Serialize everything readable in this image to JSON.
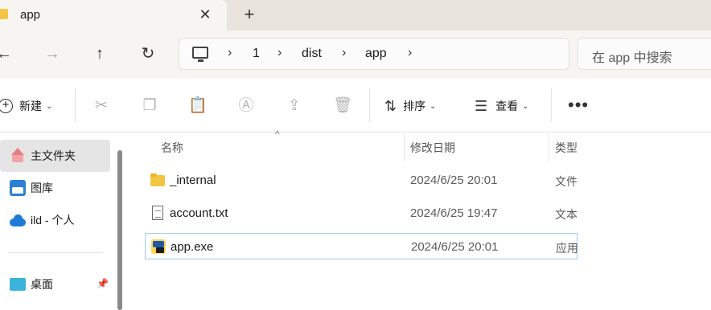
{
  "tab": {
    "title": "app",
    "close": "✕",
    "new_tab": "+"
  },
  "nav": {
    "back": "←",
    "forward": "→",
    "up": "↑",
    "refresh": "↻",
    "breadcrumb": [
      "1",
      "dist",
      "app"
    ],
    "separator": "›",
    "search_placeholder": "在 app 中搜索"
  },
  "toolbar": {
    "new_label": "新建",
    "sort_label": "排序",
    "view_label": "查看",
    "more": "•••",
    "caret": "⌄"
  },
  "sidebar": {
    "items": [
      {
        "label": "主文件夹",
        "icon": "home-icon"
      },
      {
        "label": "图库",
        "icon": "gallery-icon"
      },
      {
        "label": "ild - 个人",
        "icon": "cloud-icon"
      },
      {
        "label": "桌面",
        "icon": "desktop-icon"
      }
    ]
  },
  "filelist": {
    "columns": [
      "名称",
      "修改日期",
      "类型"
    ],
    "sort_arrow": "^",
    "rows": [
      {
        "name": "_internal",
        "date": "2024/6/25 20:01",
        "type": "文件夹",
        "icon": "folder-icon"
      },
      {
        "name": "account.txt",
        "date": "2024/6/25 19:47",
        "type": "文本文档",
        "icon": "txt-icon"
      },
      {
        "name": "app.exe",
        "date": "2024/6/25 20:01",
        "type": "应用程序",
        "icon": "exe-icon"
      }
    ]
  }
}
